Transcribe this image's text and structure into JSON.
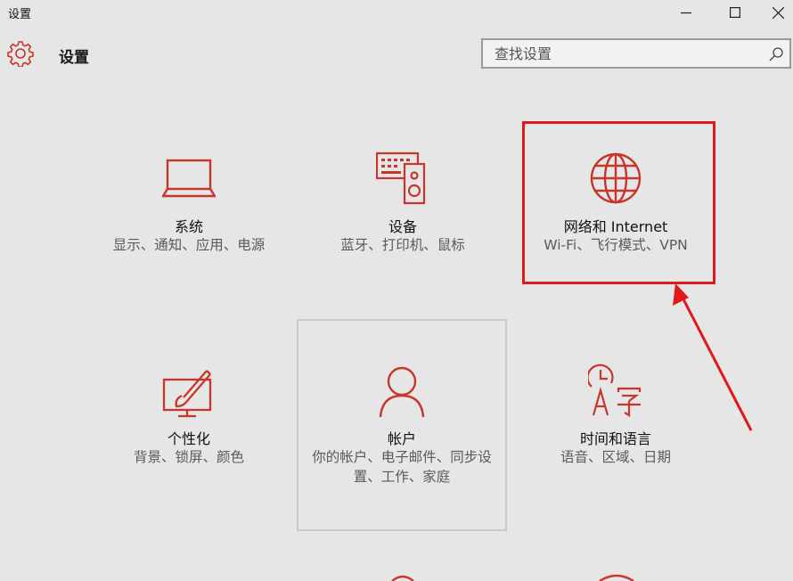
{
  "window": {
    "title": "设置"
  },
  "header": {
    "app_title": "设置"
  },
  "search": {
    "placeholder": "查找设置"
  },
  "tiles": [
    {
      "id": "system",
      "title": "系统",
      "subtitle": "显示、通知、应用、电源",
      "icon": "laptop-icon"
    },
    {
      "id": "devices",
      "title": "设备",
      "subtitle": "蓝牙、打印机、鼠标",
      "icon": "keyboard-speaker-icon"
    },
    {
      "id": "network",
      "title": "网络和 Internet",
      "subtitle": "Wi-Fi、飞行模式、VPN",
      "icon": "globe-icon"
    },
    {
      "id": "personalization",
      "title": "个性化",
      "subtitle": "背景、锁屏、颜色",
      "icon": "paint-monitor-icon"
    },
    {
      "id": "accounts",
      "title": "帐户",
      "subtitle": "你的帐户、电子邮件、同步设置、工作、家庭",
      "icon": "person-icon"
    },
    {
      "id": "time-language",
      "title": "时间和语言",
      "subtitle": "语音、区域、日期",
      "icon": "clock-language-icon"
    }
  ],
  "colors": {
    "accent": "#c8352b",
    "annotation": "#e01a1a",
    "background": "#e6e6e6"
  }
}
